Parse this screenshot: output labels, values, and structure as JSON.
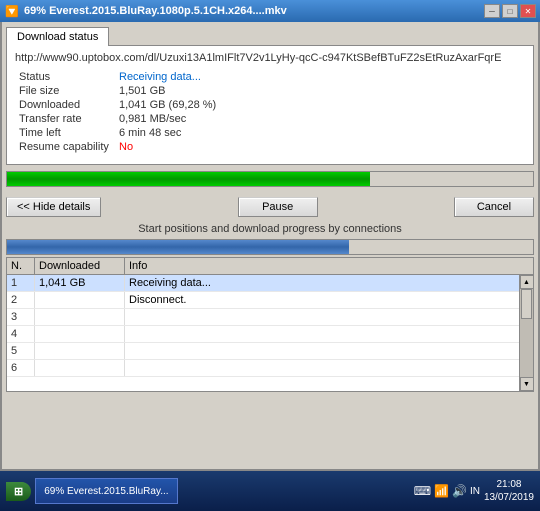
{
  "titlebar": {
    "title": "69% Everest.2015.BluRay.1080p.5.1CH.x264....mkv",
    "icon": "🔽",
    "minimize_label": "─",
    "maximize_label": "□",
    "close_label": "✕"
  },
  "tab": {
    "label": "Download status"
  },
  "details": {
    "url": "http://www90.uptobox.com/dl/Uzuxi13A1lmIFlt7V2v1LyHy-qcC-c947KtSBefBTuFZ2sEtRuzAxarFqrE",
    "status_label": "Status",
    "status_value": "Receiving data...",
    "filesize_label": "File size",
    "filesize_value": "1,501 GB",
    "downloaded_label": "Downloaded",
    "downloaded_value": "1,041 GB (69,28 %)",
    "transfer_label": "Transfer rate",
    "transfer_value": "0,981 MB/sec",
    "timeleft_label": "Time left",
    "timeleft_value": "6 min 48 sec",
    "resume_label": "Resume capability",
    "resume_value": "No"
  },
  "progress": {
    "percent": 69,
    "percent2": 65
  },
  "buttons": {
    "hide_details": "<< Hide details",
    "pause": "Pause",
    "cancel": "Cancel"
  },
  "connections_label": "Start positions and download progress by connections",
  "table": {
    "headers": {
      "n": "N.",
      "downloaded": "Downloaded",
      "info": "Info"
    },
    "rows": [
      {
        "n": "1",
        "downloaded": "1,041 GB",
        "info": "Receiving data...",
        "active": true
      },
      {
        "n": "2",
        "downloaded": "",
        "info": "Disconnect.",
        "active": false
      },
      {
        "n": "3",
        "downloaded": "",
        "info": "",
        "active": false
      },
      {
        "n": "4",
        "downloaded": "",
        "info": "",
        "active": false
      },
      {
        "n": "5",
        "downloaded": "",
        "info": "",
        "active": false
      },
      {
        "n": "6",
        "downloaded": "",
        "info": "",
        "active": false
      }
    ]
  },
  "taskbar": {
    "active_app": "69% Everest.2015.BluRay...",
    "time": "21:08",
    "date": "13/07/2019",
    "lang": "IN"
  }
}
